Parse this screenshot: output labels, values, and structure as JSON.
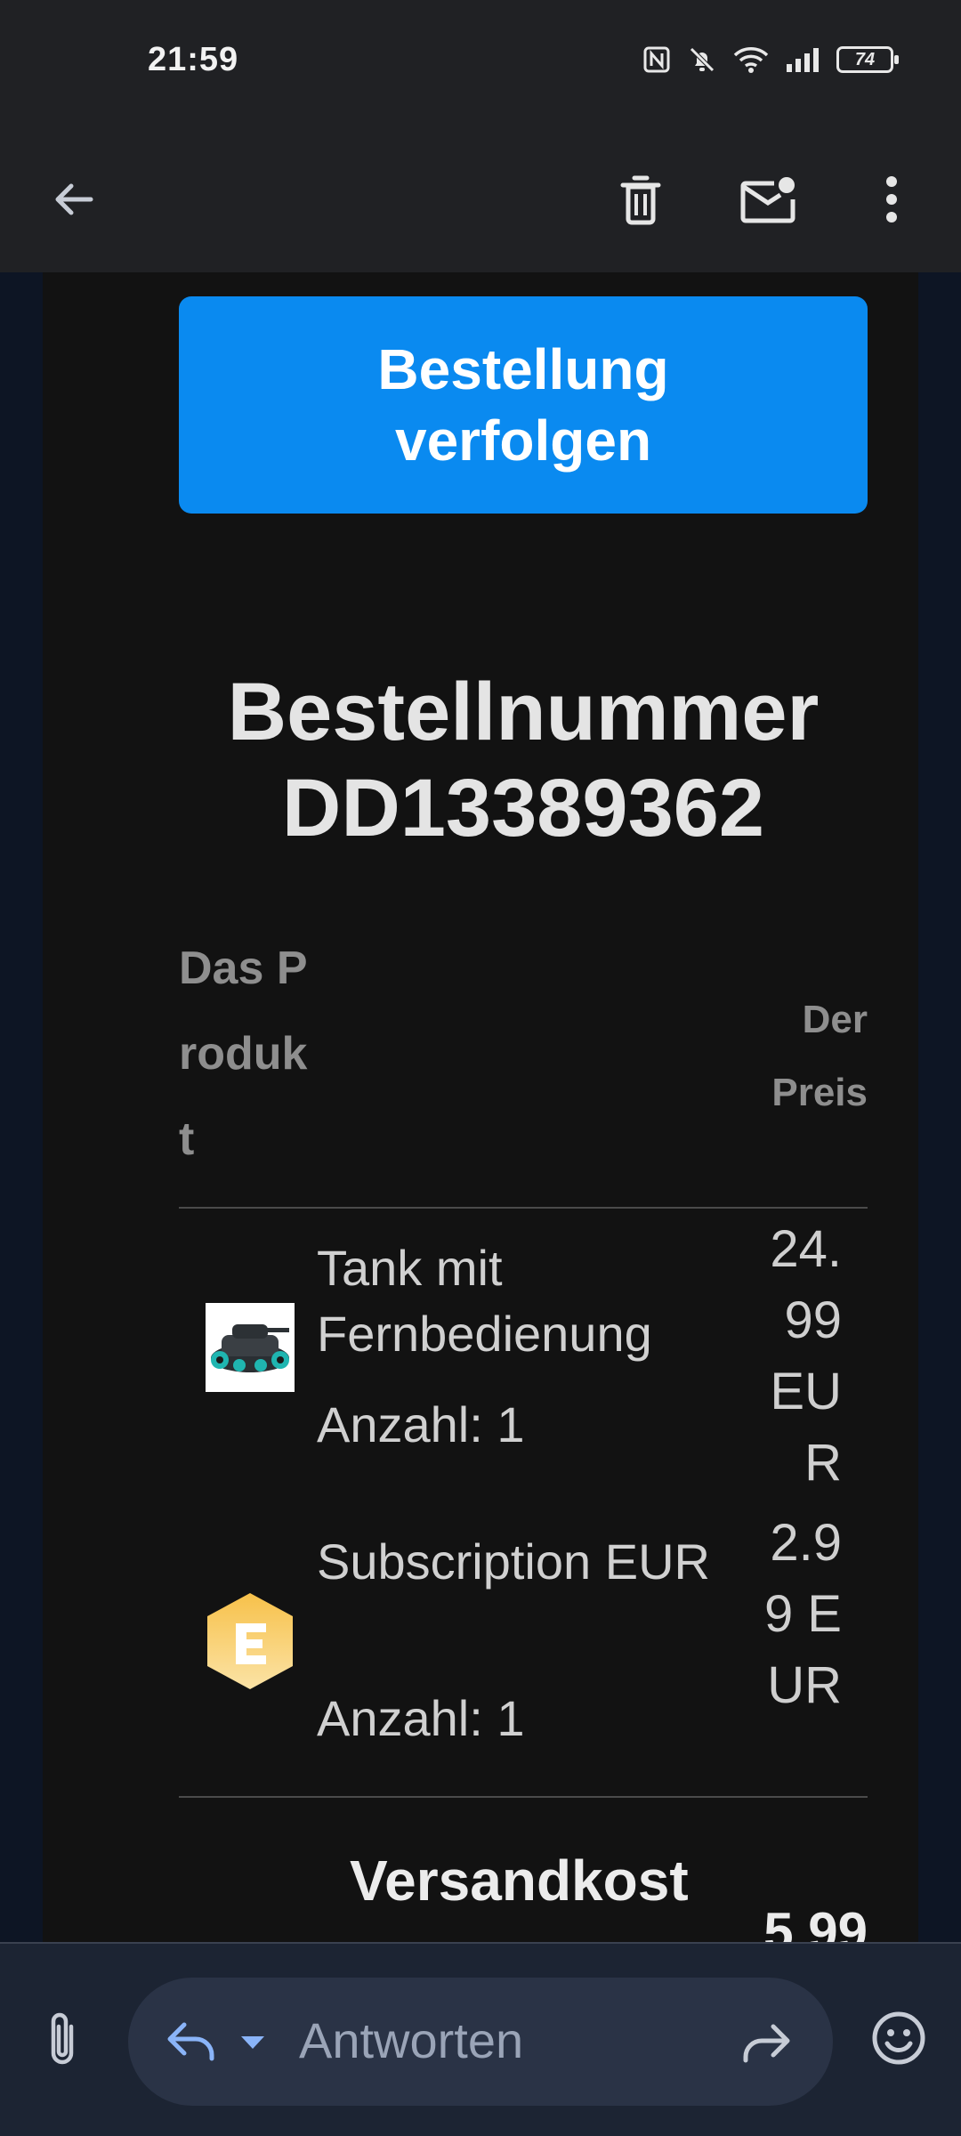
{
  "status_bar": {
    "time": "21:59",
    "battery_level": "74",
    "icons": [
      "nfc-icon",
      "bell-off-icon",
      "wifi-icon",
      "signal-icon",
      "battery-icon"
    ]
  },
  "app_bar": {
    "icons": [
      "back-arrow-icon",
      "delete-icon",
      "mark-unread-icon",
      "more-vert-icon"
    ]
  },
  "email": {
    "track_button_label": "Bestellung verfolgen",
    "order_title_line1": "Bestellnummer",
    "order_title_line2": "DD13389362",
    "table": {
      "col_product": "Das Produkt",
      "col_price": "Der Preis"
    },
    "items": [
      {
        "name": "Tank mit Fernbedienung",
        "quantity": "Anzahl: 1",
        "price": "24.99 EUR",
        "thumbnail": "rc-tank-image"
      },
      {
        "name": "Subscription EUR",
        "quantity": "Anzahl: 1",
        "price": "2.99 EUR",
        "thumbnail": "subscription-e-logo"
      }
    ],
    "shipping_label": "Versandkost",
    "shipping_value": "5.99"
  },
  "bottom_bar": {
    "reply_placeholder": "Antworten",
    "icons": [
      "attach-icon",
      "reply-icon",
      "dropdown-icon",
      "forward-icon",
      "emoji-icon"
    ]
  },
  "colors": {
    "button_blue": "#0a8af0",
    "panel": "#121212",
    "app_bar": "#202124"
  }
}
